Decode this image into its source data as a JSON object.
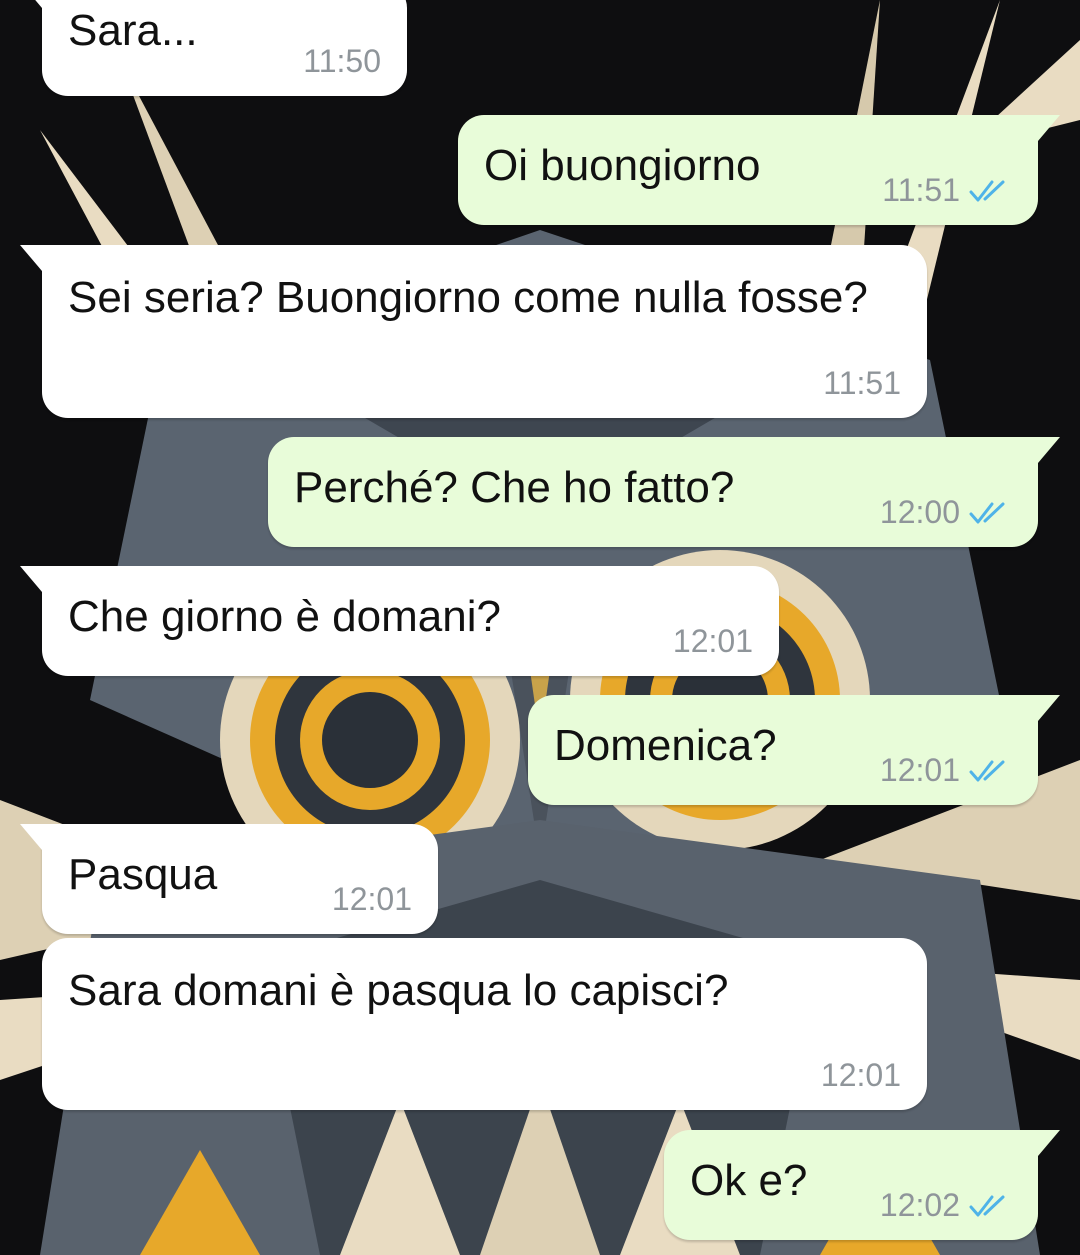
{
  "chat": {
    "messages": [
      {
        "direction": "in",
        "text": "Sara...",
        "time": "11:50"
      },
      {
        "direction": "out",
        "text": "Oi buongiorno",
        "time": "11:51",
        "status_icon": "double-check-icon"
      },
      {
        "direction": "in",
        "text": "Sei seria? Buongiorno come nulla fosse?",
        "time": "11:51"
      },
      {
        "direction": "out",
        "text": "Perché? Che ho fatto?",
        "time": "12:00",
        "status_icon": "double-check-icon"
      },
      {
        "direction": "in",
        "text": "Che giorno è domani?",
        "time": "12:01"
      },
      {
        "direction": "out",
        "text": "Domenica?",
        "time": "12:01",
        "status_icon": "double-check-icon"
      },
      {
        "direction": "in",
        "text": "Pasqua",
        "time": "12:01"
      },
      {
        "direction": "in",
        "text": "Sara domani è pasqua lo capisci?",
        "time": "12:01"
      },
      {
        "direction": "out",
        "text": "Ok e?",
        "time": "12:02",
        "status_icon": "double-check-icon"
      }
    ]
  },
  "colors": {
    "incoming_bubble": "#ffffff",
    "outgoing_bubble": "#e8fcd9",
    "read_check": "#4fb3e8",
    "timestamp": "#8f959a"
  }
}
